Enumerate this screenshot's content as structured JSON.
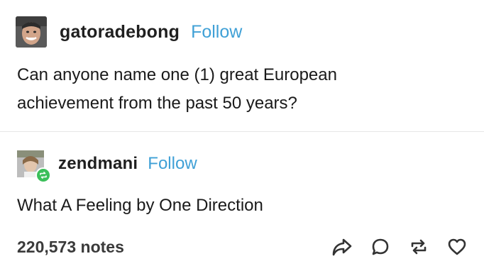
{
  "posts": [
    {
      "username": "gatoradebong",
      "follow_label": "Follow",
      "text_line_1": "Can anyone name one (1) great European",
      "text_line_2": "achievement from the past 50 years?"
    },
    {
      "username": "zendmani",
      "follow_label": "Follow",
      "text": "What A Feeling by One Direction"
    }
  ],
  "footer": {
    "notes": "220,573 notes",
    "icons": [
      "share-icon",
      "reply-icon",
      "reblog-icon",
      "like-icon"
    ]
  },
  "colors": {
    "follow": "#3fa0d6",
    "reblog_badge": "#3bbf5a",
    "text": "#1a1a1a"
  }
}
